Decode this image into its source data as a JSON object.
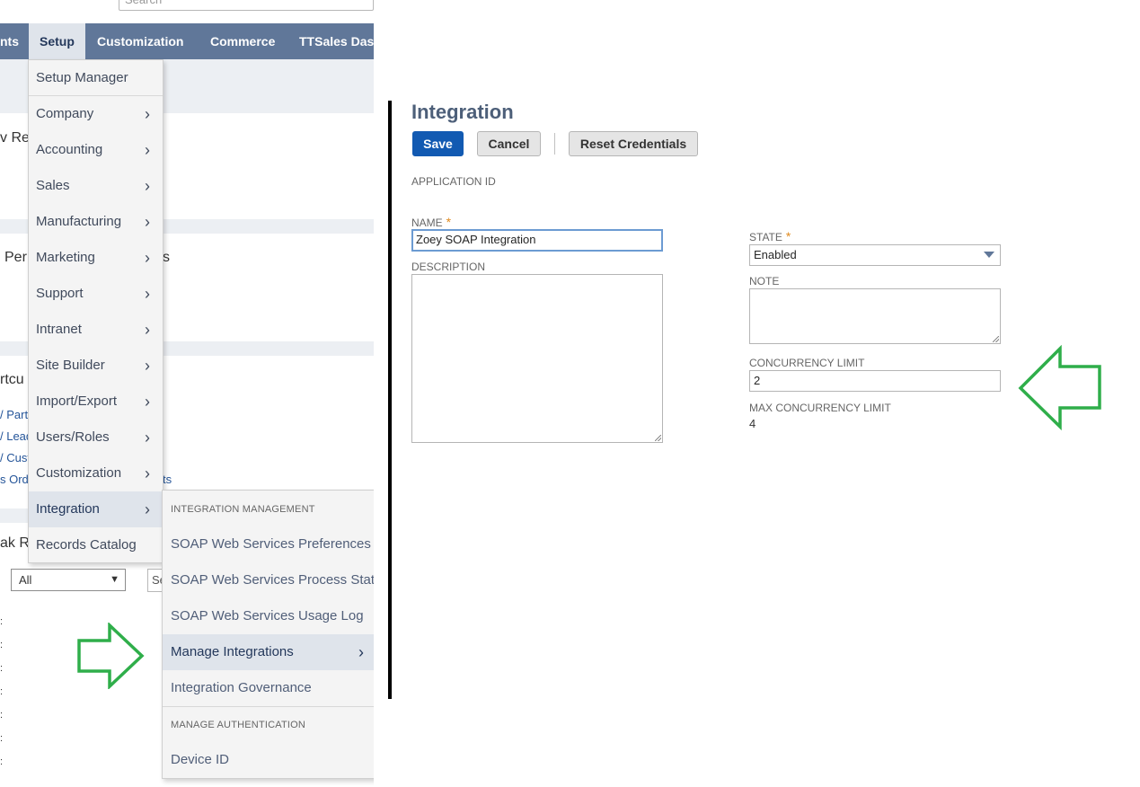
{
  "search": {
    "placeholder": "Search"
  },
  "topnav": [
    "nts",
    "Setup",
    "Customization",
    "Commerce",
    "TTSales Dash"
  ],
  "background": {
    "texts": [
      "v Re",
      "Per",
      "s",
      "rtcu",
      "ak Re",
      "ts"
    ],
    "links": [
      "/ Parti",
      "/ Lead",
      "/ Cust",
      "s Ord"
    ],
    "filter_select": "All",
    "filter_input": "Se",
    "ticks": [
      ":",
      ":",
      ":",
      ":",
      ":",
      ":",
      ":",
      ":"
    ]
  },
  "setup_menu": {
    "items": [
      {
        "label": "Setup Manager",
        "arrow": ""
      },
      {
        "label": "Company",
        "arrow": "›"
      },
      {
        "label": "Accounting",
        "arrow": "›"
      },
      {
        "label": "Sales",
        "arrow": "›"
      },
      {
        "label": "Manufacturing",
        "arrow": "›"
      },
      {
        "label": "Marketing",
        "arrow": "›"
      },
      {
        "label": "Support",
        "arrow": "›"
      },
      {
        "label": "Intranet",
        "arrow": "›"
      },
      {
        "label": "Site Builder",
        "arrow": "›"
      },
      {
        "label": "Import/Export",
        "arrow": "›"
      },
      {
        "label": "Users/Roles",
        "arrow": "›"
      },
      {
        "label": "Customization",
        "arrow": "›"
      },
      {
        "label": "Integration",
        "arrow": "›"
      },
      {
        "label": "Records Catalog",
        "arrow": ""
      }
    ]
  },
  "integration_submenu": {
    "section1": "INTEGRATION MANAGEMENT",
    "items1": [
      "SOAP Web Services Preferences",
      "SOAP Web Services Process Status",
      "SOAP Web Services Usage Log",
      "Manage Integrations",
      "Integration Governance"
    ],
    "manage_arrow": "›",
    "section2": "MANAGE AUTHENTICATION",
    "items2": [
      "Device ID"
    ]
  },
  "form": {
    "title": "Integration",
    "save": "Save",
    "cancel": "Cancel",
    "reset": "Reset Credentials",
    "application_id_label": "APPLICATION ID",
    "name_label": "NAME",
    "required_mark": "*",
    "name_value": "Zoey SOAP Integration",
    "description_label": "DESCRIPTION",
    "state_label": "STATE",
    "state_value": "Enabled",
    "note_label": "NOTE",
    "concurrency_label": "CONCURRENCY LIMIT",
    "concurrency_value": "2",
    "max_concurrency_label": "MAX CONCURRENCY LIMIT",
    "max_concurrency_value": "4"
  },
  "colors": {
    "nav_bg": "#607799",
    "primary_button": "#125ab2",
    "annotation_arrow": "#2fae4a"
  }
}
